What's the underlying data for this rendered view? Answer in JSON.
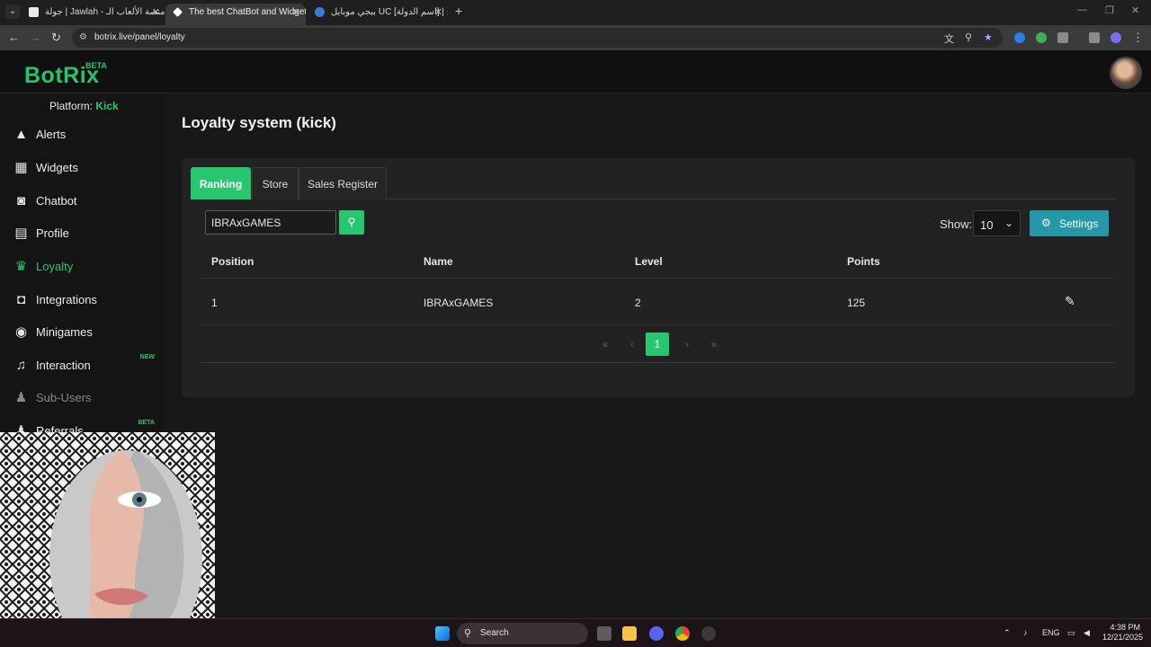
{
  "browser": {
    "tabs": [
      {
        "title": "جولة | Jawlah - منصة الألعاب الـ",
        "favicon": "jawlah-favicon"
      },
      {
        "title": "The best ChatBot and Widgets",
        "favicon": "botrix-favicon"
      },
      {
        "title": "ببجي موبايل UC [اسم الدولة] | ح...",
        "favicon": "pubg-favicon"
      }
    ],
    "url": "botrix.live/panel/loyalty"
  },
  "app": {
    "logo": "BotRix",
    "logo_badge": "BETA",
    "platform_label": "Platform:",
    "platform_value": "Kick"
  },
  "sidebar": {
    "items": [
      {
        "label": "Alerts",
        "icon": "warning-icon"
      },
      {
        "label": "Widgets",
        "icon": "grid-icon"
      },
      {
        "label": "Chatbot",
        "icon": "robot-icon"
      },
      {
        "label": "Profile",
        "icon": "id-card-icon"
      },
      {
        "label": "Loyalty",
        "icon": "trophy-icon",
        "active": true
      },
      {
        "label": "Integrations",
        "icon": "plug-icon"
      },
      {
        "label": "Minigames",
        "icon": "gamepad-icon"
      },
      {
        "label": "Interaction",
        "icon": "music-icon",
        "badge": "NEW"
      },
      {
        "label": "Sub-Users",
        "icon": "users-icon",
        "muted": true
      },
      {
        "label": "Referrals",
        "icon": "users-icon",
        "badge": "BETA"
      }
    ]
  },
  "page": {
    "title": "Loyalty system (kick)",
    "tabs": [
      "Ranking",
      "Store",
      "Sales Register"
    ],
    "search_value": "IBRAxGAMES",
    "show_label": "Show:",
    "show_value": "10",
    "settings_label": "Settings",
    "table": {
      "headers": [
        "Position",
        "Name",
        "Level",
        "Points"
      ],
      "rows": [
        {
          "position": "1",
          "name": "IBRAxGAMES",
          "level": "2",
          "points": "125"
        }
      ]
    },
    "pagination": {
      "current": "1"
    }
  },
  "taskbar": {
    "search_label": "Search",
    "language": "ENG",
    "time": "4:38 PM",
    "date": "12/21/2025"
  },
  "colors": {
    "accent": "#28c76f",
    "settings": "#2497a8",
    "background": "#181818"
  }
}
